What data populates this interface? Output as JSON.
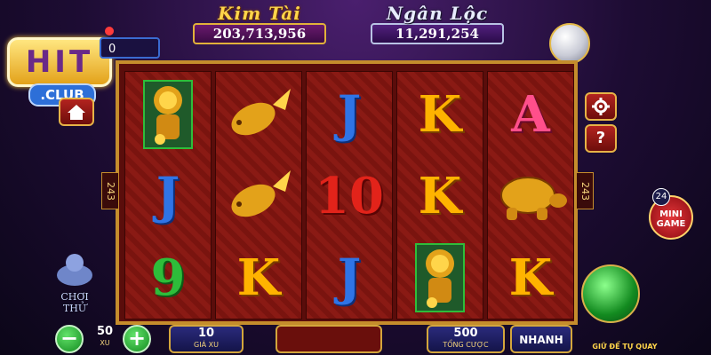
{
  "jackpots": {
    "kim_tai": {
      "title": "Kim Tài",
      "value": "203,713,956"
    },
    "ngan_loc": {
      "title": "Ngân Lộc",
      "value": "11,291,254"
    }
  },
  "logo": {
    "hit": "HIT",
    "club": ".CLUB"
  },
  "credit": {
    "value": "0"
  },
  "ways": {
    "left": "243",
    "right": "243"
  },
  "reels": [
    [
      "lion-gold",
      "J",
      "9"
    ],
    [
      "koi-gold",
      "koi-gold",
      "K"
    ],
    [
      "J",
      "10",
      "J"
    ],
    [
      "K",
      "K",
      "lion-gold"
    ],
    [
      "A",
      "turtle-gold",
      "K"
    ]
  ],
  "bottom": {
    "bet_value": "50",
    "bet_label": "XU",
    "line_value": "10",
    "line_label": "GIÁ XU",
    "total_value": "500",
    "total_label": "TỔNG CƯỢC",
    "fast_label": "NHANH",
    "spin_label": "GIỮ ĐỂ TỰ QUAY"
  },
  "side": {
    "mini_game_label_1": "MINI",
    "mini_game_label_2": "GAME",
    "mini_game_badge": "24",
    "try_label": "CHƠI THỬ"
  },
  "colors": {
    "gold": "#d4a63c",
    "reel_red": "#8a1a14",
    "letter_blue": "#2f74e6",
    "letter_red": "#e2231a",
    "letter_green": "#2ebd3a",
    "letter_pink": "#ff4f8b"
  }
}
